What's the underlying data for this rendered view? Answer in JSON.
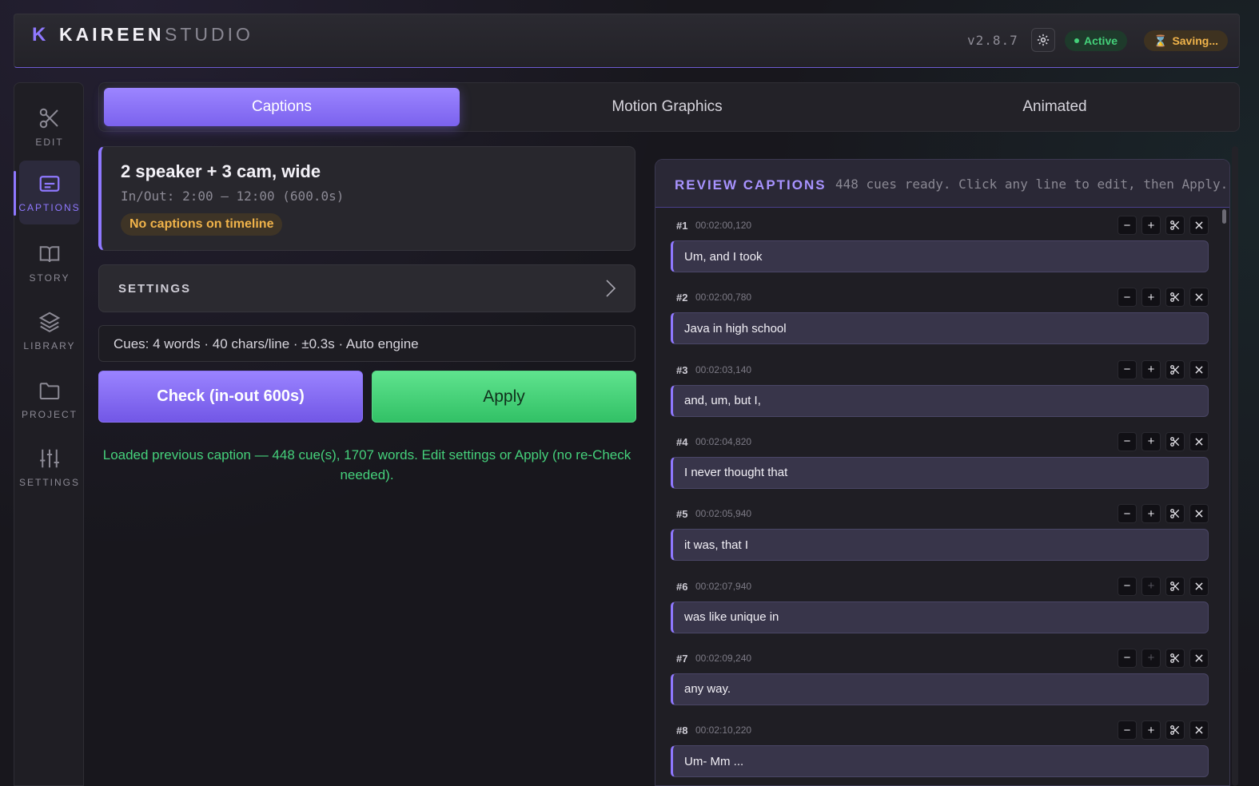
{
  "header": {
    "logo": "K",
    "brand": "KAIREEN",
    "brand_sub": "STUDIO",
    "version": "v2.8.7",
    "status_active": "Active",
    "status_saving": "Saving..."
  },
  "sidebar": {
    "items": [
      {
        "label": "EDIT",
        "icon": "scissors-icon"
      },
      {
        "label": "CAPTIONS",
        "icon": "captions-icon"
      },
      {
        "label": "STORY",
        "icon": "book-icon"
      },
      {
        "label": "LIBRARY",
        "icon": "layers-icon"
      },
      {
        "label": "PROJECT",
        "icon": "folder-icon"
      },
      {
        "label": "SETTINGS",
        "icon": "sliders-icon"
      }
    ]
  },
  "tabs": [
    {
      "label": "Captions",
      "active": true
    },
    {
      "label": "Motion Graphics",
      "active": false
    },
    {
      "label": "Animated",
      "active": false
    }
  ],
  "project": {
    "title": "2 speaker + 3 cam, wide",
    "inout": "In/Out: 2:00 – 12:00 (600.0s)",
    "badge": "No captions on timeline"
  },
  "settings": {
    "label": "SETTINGS"
  },
  "cues_summary": "Cues: 4 words · 40 chars/line · ±0.3s · Auto engine",
  "buttons": {
    "check": "Check (in-out 600s)",
    "apply": "Apply"
  },
  "status_message": "Loaded previous caption — 448 cue(s), 1707 words. Edit settings or Apply (no re-Check needed).",
  "review": {
    "title": "REVIEW CAPTIONS",
    "subtitle": "448 cues ready. Click any line to edit, then Apply.",
    "cues": [
      {
        "num": "#1",
        "time": "00:02:00,120",
        "text": "Um, and I took",
        "plus_disabled": false
      },
      {
        "num": "#2",
        "time": "00:02:00,780",
        "text": "Java in high school",
        "plus_disabled": false
      },
      {
        "num": "#3",
        "time": "00:02:03,140",
        "text": "and, um, but I,",
        "plus_disabled": false
      },
      {
        "num": "#4",
        "time": "00:02:04,820",
        "text": "I never thought that",
        "plus_disabled": false
      },
      {
        "num": "#5",
        "time": "00:02:05,940",
        "text": "it was, that I",
        "plus_disabled": false
      },
      {
        "num": "#6",
        "time": "00:02:07,940",
        "text": "was like unique in",
        "plus_disabled": true
      },
      {
        "num": "#7",
        "time": "00:02:09,240",
        "text": "any way.",
        "plus_disabled": true
      },
      {
        "num": "#8",
        "time": "00:02:10,220",
        "text": "Um- Mm ...",
        "plus_disabled": false
      }
    ]
  },
  "colors": {
    "accent": "#8f78ff",
    "success": "#45d07b",
    "warning": "#f0b34a",
    "background": "#18171d"
  }
}
